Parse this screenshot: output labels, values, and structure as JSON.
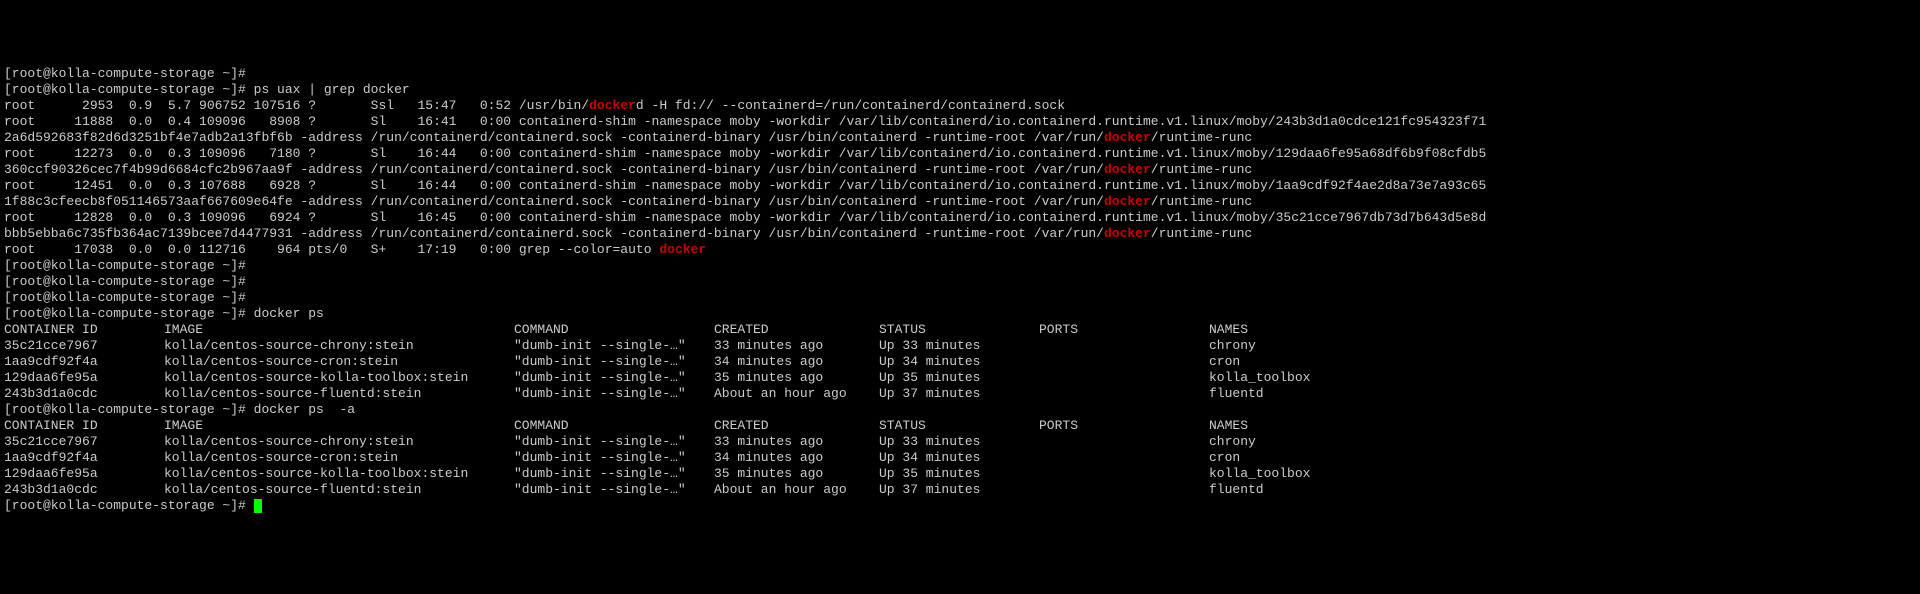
{
  "prompt": {
    "user": "root",
    "host": "kolla-compute-storage",
    "path": "~",
    "symbol": "#"
  },
  "first_line": "[root@kolla-compute-storage ~]#",
  "commands": {
    "ps_grep": "ps uax | grep docker",
    "docker_ps": "docker ps",
    "docker_ps_a": "docker ps  -a"
  },
  "ps_output": {
    "rows": [
      {
        "user": "root",
        "pid": "2953",
        "cpu": "0.9",
        "mem": "5.7",
        "vsz": "906752",
        "rss": "107516",
        "tty": "?",
        "stat": "Ssl",
        "start": "15:47",
        "time": "0:52",
        "cmd_pre": "/usr/bin/",
        "hl": "docker",
        "cmd_post": "d -H fd:// --containerd=/run/containerd/containerd.sock"
      },
      {
        "user": "root",
        "pid": "11888",
        "cpu": "0.0",
        "mem": "0.4",
        "vsz": "109096",
        "rss": "8908",
        "tty": "?",
        "stat": "Sl",
        "start": "16:41",
        "time": "0:00",
        "cmd_pre": "containerd-shim -namespace moby -workdir /var/lib/containerd/io.containerd.runtime.v1.linux/moby/243b3d1a0cdce121fc954323f71",
        "hl": "",
        "cmd_post": ""
      },
      {
        "cont_pre": "2a6d592683f82d6d3251bf4e7adb2a13fbf6b -address /run/containerd/containerd.sock -containerd-binary /usr/bin/containerd -runtime-root /var/run/",
        "hl": "docker",
        "cont_post": "/runtime-runc"
      },
      {
        "user": "root",
        "pid": "12273",
        "cpu": "0.0",
        "mem": "0.3",
        "vsz": "109096",
        "rss": "7180",
        "tty": "?",
        "stat": "Sl",
        "start": "16:44",
        "time": "0:00",
        "cmd_pre": "containerd-shim -namespace moby -workdir /var/lib/containerd/io.containerd.runtime.v1.linux/moby/129daa6fe95a68df6b9f08cfdb5",
        "hl": "",
        "cmd_post": ""
      },
      {
        "cont_pre": "360ccf90326cec7f4b99d6684cfc2b967aa9f -address /run/containerd/containerd.sock -containerd-binary /usr/bin/containerd -runtime-root /var/run/",
        "hl": "docker",
        "cont_post": "/runtime-runc"
      },
      {
        "user": "root",
        "pid": "12451",
        "cpu": "0.0",
        "mem": "0.3",
        "vsz": "107688",
        "rss": "6928",
        "tty": "?",
        "stat": "Sl",
        "start": "16:44",
        "time": "0:00",
        "cmd_pre": "containerd-shim -namespace moby -workdir /var/lib/containerd/io.containerd.runtime.v1.linux/moby/1aa9cdf92f4ae2d8a73e7a93c65",
        "hl": "",
        "cmd_post": ""
      },
      {
        "cont_pre": "1f88c3cfeecb8f051146573aaf667609e64fe -address /run/containerd/containerd.sock -containerd-binary /usr/bin/containerd -runtime-root /var/run/",
        "hl": "docker",
        "cont_post": "/runtime-runc"
      },
      {
        "user": "root",
        "pid": "12828",
        "cpu": "0.0",
        "mem": "0.3",
        "vsz": "109096",
        "rss": "6924",
        "tty": "?",
        "stat": "Sl",
        "start": "16:45",
        "time": "0:00",
        "cmd_pre": "containerd-shim -namespace moby -workdir /var/lib/containerd/io.containerd.runtime.v1.linux/moby/35c21cce7967db73d7b643d5e8d",
        "hl": "",
        "cmd_post": ""
      },
      {
        "cont_pre": "bbb5ebba6c735fb364ac7139bcee7d4477931 -address /run/containerd/containerd.sock -containerd-binary /usr/bin/containerd -runtime-root /var/run/",
        "hl": "docker",
        "cont_post": "/runtime-runc"
      },
      {
        "user": "root",
        "pid": "17038",
        "cpu": "0.0",
        "mem": "0.0",
        "vsz": "112716",
        "rss": "964",
        "tty": "pts/0",
        "stat": "S+",
        "start": "17:19",
        "time": "0:00",
        "cmd_pre": "grep --color=auto ",
        "hl": "docker",
        "cmd_post": ""
      }
    ]
  },
  "docker_headers": {
    "cid": "CONTAINER ID",
    "image": "IMAGE",
    "cmd": "COMMAND",
    "created": "CREATED",
    "status": "STATUS",
    "ports": "PORTS",
    "names": "NAMES"
  },
  "containers": [
    {
      "id": "35c21cce7967",
      "image": "kolla/centos-source-chrony:stein",
      "command": "\"dumb-init --single-…\"",
      "created": "33 minutes ago",
      "status": "Up 33 minutes",
      "ports": "",
      "names": "chrony"
    },
    {
      "id": "1aa9cdf92f4a",
      "image": "kolla/centos-source-cron:stein",
      "command": "\"dumb-init --single-…\"",
      "created": "34 minutes ago",
      "status": "Up 34 minutes",
      "ports": "",
      "names": "cron"
    },
    {
      "id": "129daa6fe95a",
      "image": "kolla/centos-source-kolla-toolbox:stein",
      "command": "\"dumb-init --single-…\"",
      "created": "35 minutes ago",
      "status": "Up 35 minutes",
      "ports": "",
      "names": "kolla_toolbox"
    },
    {
      "id": "243b3d1a0cdc",
      "image": "kolla/centos-source-fluentd:stein",
      "command": "\"dumb-init --single-…\"",
      "created": "About an hour ago",
      "status": "Up 37 minutes",
      "ports": "",
      "names": "fluentd"
    }
  ]
}
